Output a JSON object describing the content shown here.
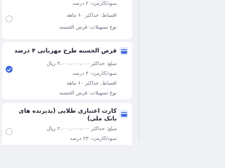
{
  "cards": [
    {
      "title": "",
      "rows": [
        "سود/کارمزد: ۲ درصد",
        "اقساط: حداکثر ۶۰ ماهه",
        "نوع تسهیلات: قرض الحسنه"
      ],
      "selected": false
    },
    {
      "title": "قرض الحسنه طرح مهربانی ۴ درصد",
      "rows": [
        "مبلغ: حداکثر ۳،۰۰۰،۰۰۰،۰۰۰ ریال",
        "سود/کارمزد: ۴ درصد",
        "اقساط: حداکثر ۶۰ ماهه",
        "نوع تسهیلات: قرض الحسنه"
      ],
      "selected": true,
      "icon": "card-icon"
    },
    {
      "title": "کارت اعتباری طلایی (پذیرنده های بانک ملی)",
      "rows": [
        "مبلغ: حداکثر ۲،۰۰۰،۰۰۰،۰۰۰ ریال",
        "سود/کارمزد: ۲۳ درصد"
      ],
      "selected": false,
      "icon": "card-icon"
    }
  ],
  "colors": {
    "accent": "#3d67e0",
    "background": "#f0f1f5",
    "card": "#ffffff",
    "icon_bg": "#e7ecfb"
  }
}
